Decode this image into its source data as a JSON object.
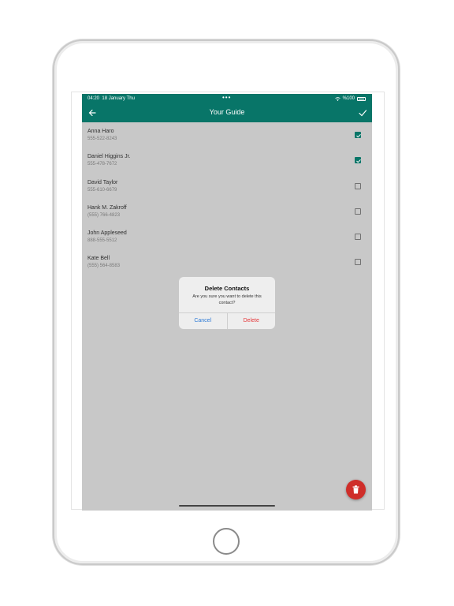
{
  "status_bar": {
    "time": "04:20",
    "date": "18 January Thu",
    "dots": "•••",
    "battery_text": "%100"
  },
  "app_bar": {
    "title": "Your Guide",
    "back_icon": "arrow-left-icon",
    "confirm_icon": "checkmark-icon"
  },
  "contacts": [
    {
      "name": "Anna Haro",
      "phone": "555-522-8243",
      "checked": true
    },
    {
      "name": "Daniel Higgins Jr.",
      "phone": "555-478-7672",
      "checked": true
    },
    {
      "name": "David Taylor",
      "phone": "555-610-6679",
      "checked": false
    },
    {
      "name": "Hank M. Zakroff",
      "phone": "(555) 766-4823",
      "checked": false
    },
    {
      "name": "John Appleseed",
      "phone": "888-555-5512",
      "checked": false
    },
    {
      "name": "Kate Bell",
      "phone": "(555) 564-8583",
      "checked": false
    }
  ],
  "dialog": {
    "title": "Delete Contacts",
    "message": "Are you sure you want to delete this contact?",
    "cancel_label": "Cancel",
    "delete_label": "Delete"
  },
  "fab": {
    "icon": "trash-icon"
  },
  "colors": {
    "primary": "#087568",
    "fab": "#cf2e2a",
    "cancel": "#2e7bd6",
    "delete": "#e5383b"
  }
}
